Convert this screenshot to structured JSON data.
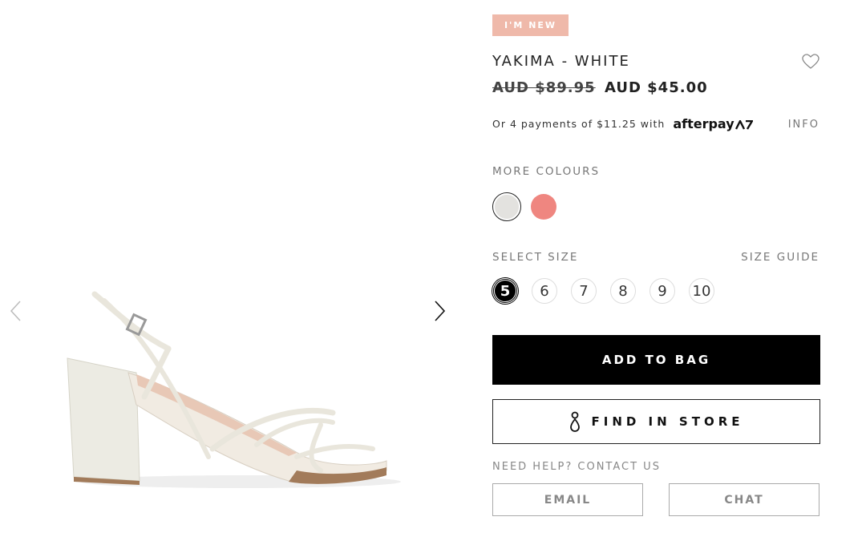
{
  "badge": "I'M NEW",
  "product": {
    "name": "YAKIMA - WHITE",
    "old_price": "AUD $89.95",
    "price": "AUD $45.00"
  },
  "afterpay": {
    "text": "Or 4 payments of $11.25 with",
    "logo": "afterpay",
    "info": "INFO"
  },
  "colours": {
    "label": "MORE COLOURS",
    "items": [
      {
        "name": "white",
        "color": "#e3e2df",
        "selected": true
      },
      {
        "name": "pink",
        "color": "#ef8680",
        "selected": false
      }
    ]
  },
  "sizes": {
    "label": "SELECT SIZE",
    "guide": "SIZE GUIDE",
    "options": [
      "5",
      "6",
      "7",
      "8",
      "9",
      "10"
    ],
    "selected": "5"
  },
  "buttons": {
    "add_to_bag": "ADD TO BAG",
    "find_in_store": "FIND IN STORE"
  },
  "help": {
    "label": "NEED HELP? CONTACT US",
    "email": "EMAIL",
    "chat": "CHAT"
  },
  "icons": {
    "prev": "chevron-left-icon",
    "next": "chevron-right-icon",
    "wishlist": "heart-icon",
    "store": "location-pin-icon"
  }
}
